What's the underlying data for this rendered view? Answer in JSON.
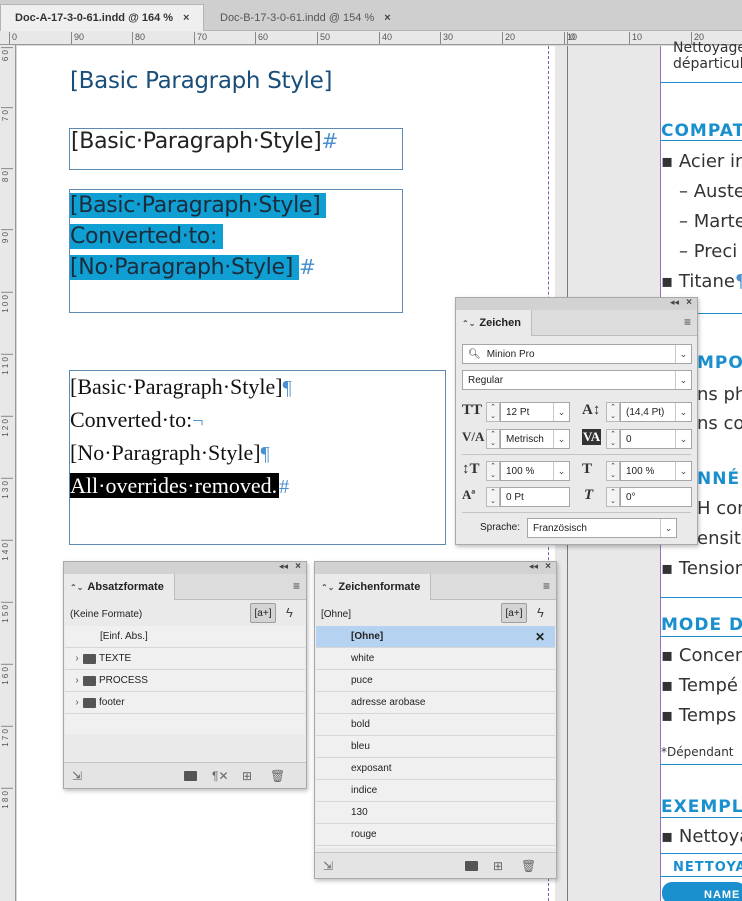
{
  "tabs": [
    {
      "label": "Doc-A-17-3-0-61.indd @ 164 %",
      "close": "×"
    },
    {
      "label": "Doc-B-17-3-0-61.indd @ 154 %",
      "close": "×"
    }
  ],
  "ruler": {
    "h_labels": [
      "0",
      "90",
      "80",
      "70",
      "60",
      "50",
      "40",
      "30",
      "20",
      "10",
      "0",
      "10",
      "20",
      "30"
    ],
    "v_labels": [
      "6 0",
      "7 0",
      "8 0",
      "9 0",
      "1 0 0",
      "1 1 0",
      "1 2 0",
      "1 3 0",
      "1 4 0",
      "1 5 0",
      "1 6 0",
      "1 7 0",
      "1 8 0"
    ]
  },
  "page1": {
    "heading": "[Basic Paragraph Style]",
    "frame1": {
      "text": "[Basic·Paragraph·Style]",
      "mark": "#"
    },
    "frame2": {
      "line1": "[Basic·Paragraph·Style]",
      "line2": "Converted·to:",
      "line3": "[No·Paragraph·Style]",
      "mark": "#"
    },
    "frame3": {
      "line1": "[Basic·Paragraph·Style]",
      "line1_mark": "¶",
      "line2": "Converted·to:",
      "line2_mark": "¬",
      "line3": "[No·Paragraph·Style]",
      "line3_mark": "¶",
      "line4": "All·overrides·removed.",
      "line4_mark": "#"
    }
  },
  "page2": {
    "top1": "Nettoyage",
    "top2": "départicul",
    "head1": "COMPAT",
    "b1": "Acier in",
    "b2": "– Auste",
    "b3": "– Marte",
    "b4": "– Preci",
    "b5": "Titane",
    "b5_mark": "¶",
    "head2": "MPO",
    "b6": "ns ph",
    "b7": "ns co",
    "head3": "NNÉ",
    "b8": "H con",
    "b9": "ensite",
    "b10": "Tension",
    "head4": "MODE D",
    "b11": "Concen",
    "b12": "Tempé",
    "b13": "Temps",
    "note": "*Dépendant",
    "head5": "EXEMPL",
    "b14": "Nettoya",
    "head6": "NETTOYA",
    "button": "NAME"
  },
  "zeichen_panel": {
    "title": "Zeichen",
    "font": "Minion Pro",
    "style": "Regular",
    "size": "12 Pt",
    "leading": "(14,4 Pt)",
    "kerning": "Metrisch",
    "tracking": "0",
    "vscale": "100 %",
    "hscale": "100 %",
    "baseline": "0 Pt",
    "skew": "0°",
    "language_label": "Sprache:",
    "language": "Französisch"
  },
  "absatz_panel": {
    "title": "Absatzformate",
    "current": "(Keine Formate)",
    "new_style": "[a+]",
    "items": [
      {
        "label": "[Einf. Abs.]",
        "folder": false
      },
      {
        "label": "TEXTE",
        "folder": true
      },
      {
        "label": "PROCESS",
        "folder": true
      },
      {
        "label": "footer",
        "folder": true
      }
    ]
  },
  "zeichenformate_panel": {
    "title": "Zeichenformate",
    "current": "[Ohne]",
    "new_style": "[a+]",
    "items": [
      "[Ohne]",
      "white",
      "puce",
      "adresse arobase",
      "bold",
      "bleu",
      "exposant",
      "indice",
      "130",
      "rouge"
    ]
  }
}
